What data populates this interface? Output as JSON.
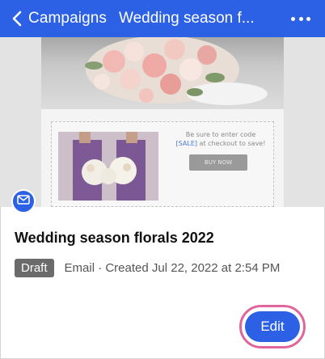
{
  "header": {
    "back_label": "Campaigns",
    "title": "Wedding season f...",
    "more_icon": "more-horizontal-icon"
  },
  "preview": {
    "promo_line1": "Be sure to enter code",
    "promo_code": "[SALE]",
    "promo_line2_rest": " at checkout to save!",
    "buy_button": "BUY NOW"
  },
  "campaign": {
    "title": "Wedding season florals 2022",
    "status": "Draft",
    "meta": "Email · Created Jul 22, 2022 at 2:54 PM",
    "type_icon": "mail-icon"
  },
  "actions": {
    "edit_label": "Edit"
  },
  "colors": {
    "accent": "#2c61e6",
    "highlight_ring": "#e0659c",
    "status_badge": "#6b6b6b"
  }
}
